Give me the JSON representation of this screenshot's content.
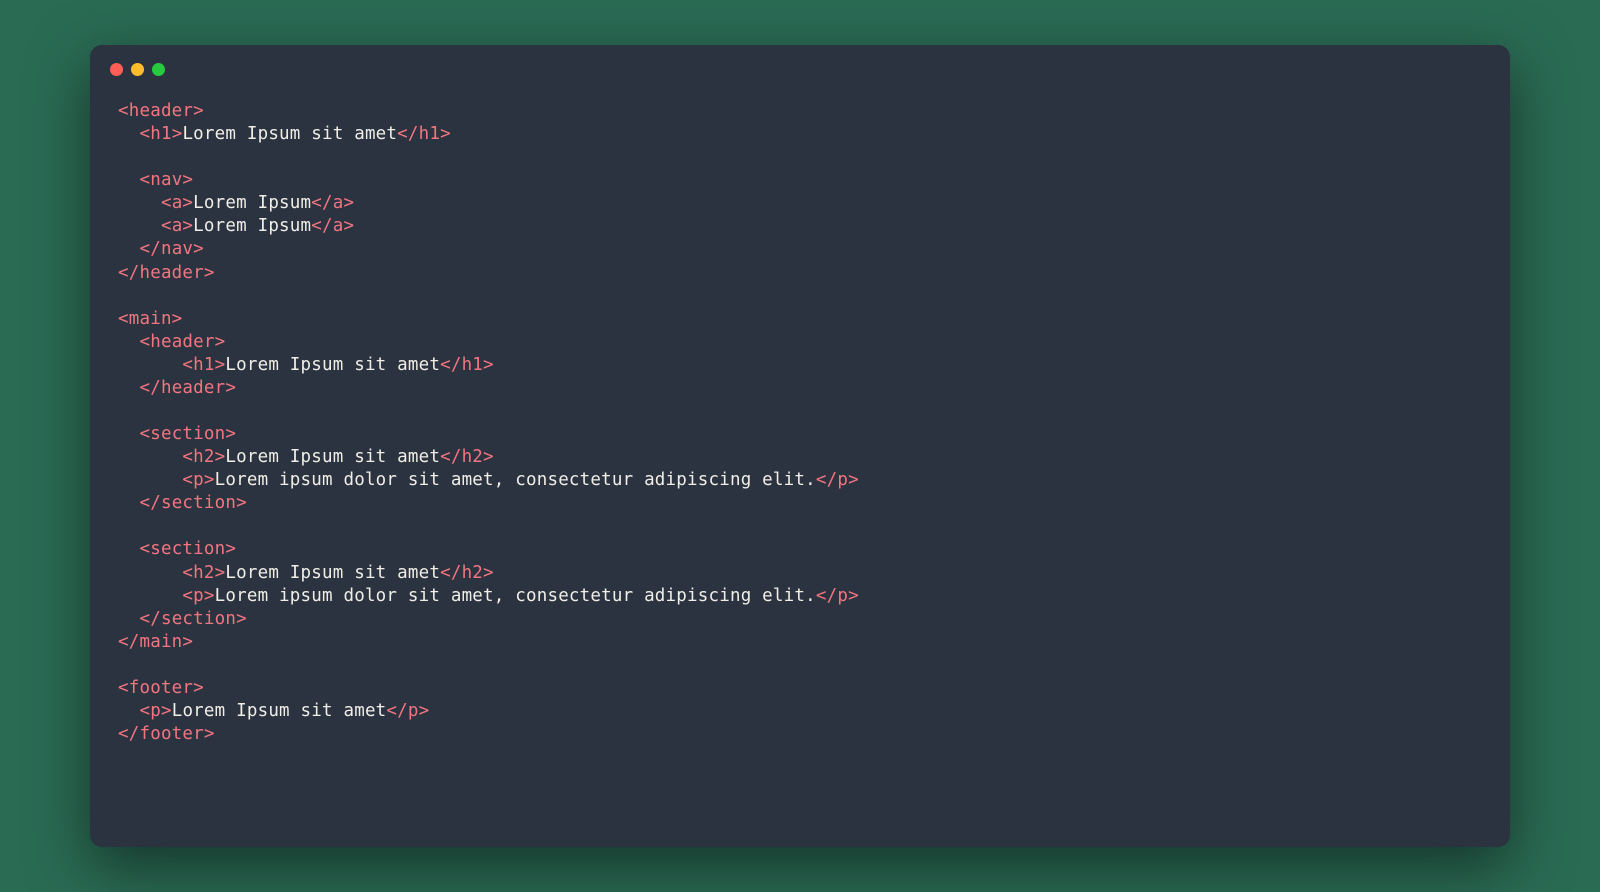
{
  "code": {
    "lines": [
      {
        "segments": [
          {
            "t": "tag",
            "v": "<header>"
          }
        ]
      },
      {
        "segments": [
          {
            "t": "indent",
            "v": "  "
          },
          {
            "t": "tag",
            "v": "<h1>"
          },
          {
            "t": "txt",
            "v": "Lorem Ipsum sit amet"
          },
          {
            "t": "tag",
            "v": "</h1>"
          }
        ]
      },
      {
        "segments": []
      },
      {
        "segments": [
          {
            "t": "indent",
            "v": "  "
          },
          {
            "t": "tag",
            "v": "<nav>"
          }
        ]
      },
      {
        "segments": [
          {
            "t": "indent",
            "v": "    "
          },
          {
            "t": "tag",
            "v": "<a>"
          },
          {
            "t": "txt",
            "v": "Lorem Ipsum"
          },
          {
            "t": "tag",
            "v": "</a>"
          }
        ]
      },
      {
        "segments": [
          {
            "t": "indent",
            "v": "    "
          },
          {
            "t": "tag",
            "v": "<a>"
          },
          {
            "t": "txt",
            "v": "Lorem Ipsum"
          },
          {
            "t": "tag",
            "v": "</a>"
          }
        ]
      },
      {
        "segments": [
          {
            "t": "indent",
            "v": "  "
          },
          {
            "t": "tag",
            "v": "</nav>"
          }
        ]
      },
      {
        "segments": [
          {
            "t": "tag",
            "v": "</header>"
          }
        ]
      },
      {
        "segments": []
      },
      {
        "segments": [
          {
            "t": "tag",
            "v": "<main>"
          }
        ]
      },
      {
        "segments": [
          {
            "t": "indent",
            "v": "  "
          },
          {
            "t": "tag",
            "v": "<header>"
          }
        ]
      },
      {
        "segments": [
          {
            "t": "indent",
            "v": "      "
          },
          {
            "t": "tag",
            "v": "<h1>"
          },
          {
            "t": "txt",
            "v": "Lorem Ipsum sit amet"
          },
          {
            "t": "tag",
            "v": "</h1>"
          }
        ]
      },
      {
        "segments": [
          {
            "t": "indent",
            "v": "  "
          },
          {
            "t": "tag",
            "v": "</header>"
          }
        ]
      },
      {
        "segments": []
      },
      {
        "segments": [
          {
            "t": "indent",
            "v": "  "
          },
          {
            "t": "tag",
            "v": "<section>"
          }
        ]
      },
      {
        "segments": [
          {
            "t": "indent",
            "v": "      "
          },
          {
            "t": "tag",
            "v": "<h2>"
          },
          {
            "t": "txt",
            "v": "Lorem Ipsum sit amet"
          },
          {
            "t": "tag",
            "v": "</h2>"
          }
        ]
      },
      {
        "segments": [
          {
            "t": "indent",
            "v": "      "
          },
          {
            "t": "tag",
            "v": "<p>"
          },
          {
            "t": "txt",
            "v": "Lorem ipsum dolor sit amet, consectetur adipiscing elit."
          },
          {
            "t": "tag",
            "v": "</p>"
          }
        ]
      },
      {
        "segments": [
          {
            "t": "indent",
            "v": "  "
          },
          {
            "t": "tag",
            "v": "</section>"
          }
        ]
      },
      {
        "segments": []
      },
      {
        "segments": [
          {
            "t": "indent",
            "v": "  "
          },
          {
            "t": "tag",
            "v": "<section>"
          }
        ]
      },
      {
        "segments": [
          {
            "t": "indent",
            "v": "      "
          },
          {
            "t": "tag",
            "v": "<h2>"
          },
          {
            "t": "txt",
            "v": "Lorem Ipsum sit amet"
          },
          {
            "t": "tag",
            "v": "</h2>"
          }
        ]
      },
      {
        "segments": [
          {
            "t": "indent",
            "v": "      "
          },
          {
            "t": "tag",
            "v": "<p>"
          },
          {
            "t": "txt",
            "v": "Lorem ipsum dolor sit amet, consectetur adipiscing elit."
          },
          {
            "t": "tag",
            "v": "</p>"
          }
        ]
      },
      {
        "segments": [
          {
            "t": "indent",
            "v": "  "
          },
          {
            "t": "tag",
            "v": "</section>"
          }
        ]
      },
      {
        "segments": [
          {
            "t": "tag",
            "v": "</main>"
          }
        ]
      },
      {
        "segments": []
      },
      {
        "segments": [
          {
            "t": "tag",
            "v": "<footer>"
          }
        ]
      },
      {
        "segments": [
          {
            "t": "indent",
            "v": "  "
          },
          {
            "t": "tag",
            "v": "<p>"
          },
          {
            "t": "txt",
            "v": "Lorem Ipsum sit amet"
          },
          {
            "t": "tag",
            "v": "</p>"
          }
        ]
      },
      {
        "segments": [
          {
            "t": "tag",
            "v": "</footer>"
          }
        ]
      }
    ]
  }
}
